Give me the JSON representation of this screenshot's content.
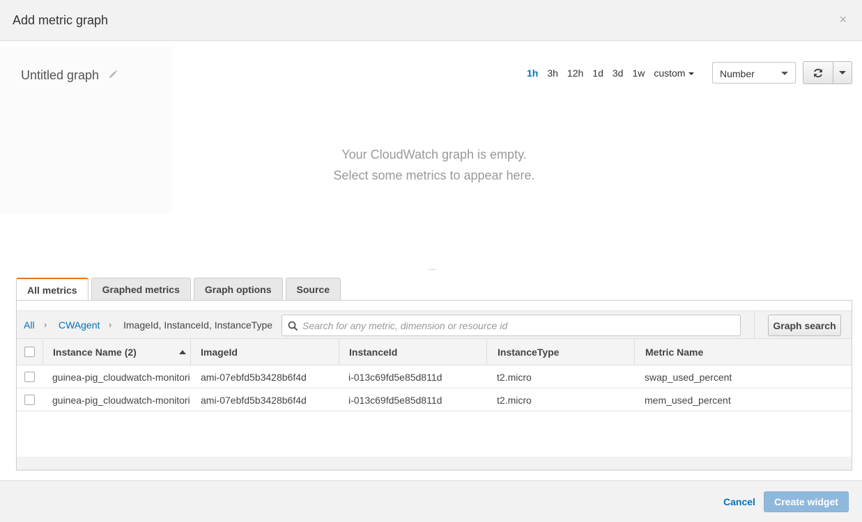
{
  "dialog": {
    "title": "Add metric graph",
    "close_glyph": "×"
  },
  "graph": {
    "title": "Untitled graph",
    "time_ranges": [
      "1h",
      "3h",
      "12h",
      "1d",
      "3d",
      "1w"
    ],
    "active_range": "1h",
    "custom_label": "custom",
    "view_type": "Number",
    "empty_line1": "Your CloudWatch graph is empty.",
    "empty_line2": "Select some metrics to appear here.",
    "resize_glyph": "---"
  },
  "tabs": [
    "All metrics",
    "Graphed metrics",
    "Graph options",
    "Source"
  ],
  "active_tab": "All metrics",
  "breadcrumb": {
    "all": "All",
    "namespace": "CWAgent",
    "dimensions": "ImageId, InstanceId, InstanceType",
    "separator": "›"
  },
  "search": {
    "placeholder": "Search for any metric, dimension or resource id",
    "value": ""
  },
  "graph_search_label": "Graph search",
  "table": {
    "columns": [
      "Instance Name (2)",
      "ImageId",
      "InstanceId",
      "InstanceType",
      "Metric Name"
    ],
    "sorted_column": "Instance Name (2)",
    "rows": [
      [
        "guinea-pig_cloudwatch-monitori",
        "ami-07ebfd5b3428b6f4d",
        "i-013c69fd5e85d811d",
        "t2.micro",
        "swap_used_percent"
      ],
      [
        "guinea-pig_cloudwatch-monitori",
        "ami-07ebfd5b3428b6f4d",
        "i-013c69fd5e85d811d",
        "t2.micro",
        "mem_used_percent"
      ]
    ]
  },
  "footer": {
    "cancel_label": "Cancel",
    "create_label": "Create widget"
  },
  "colors": {
    "link": "#0073bb",
    "active_tab_accent": "#ec7211",
    "primary_disabled": "#8fb9dc"
  },
  "icons": {
    "edit": "pencil-icon",
    "refresh": "refresh-icon",
    "search": "search-icon",
    "close": "close-icon"
  }
}
